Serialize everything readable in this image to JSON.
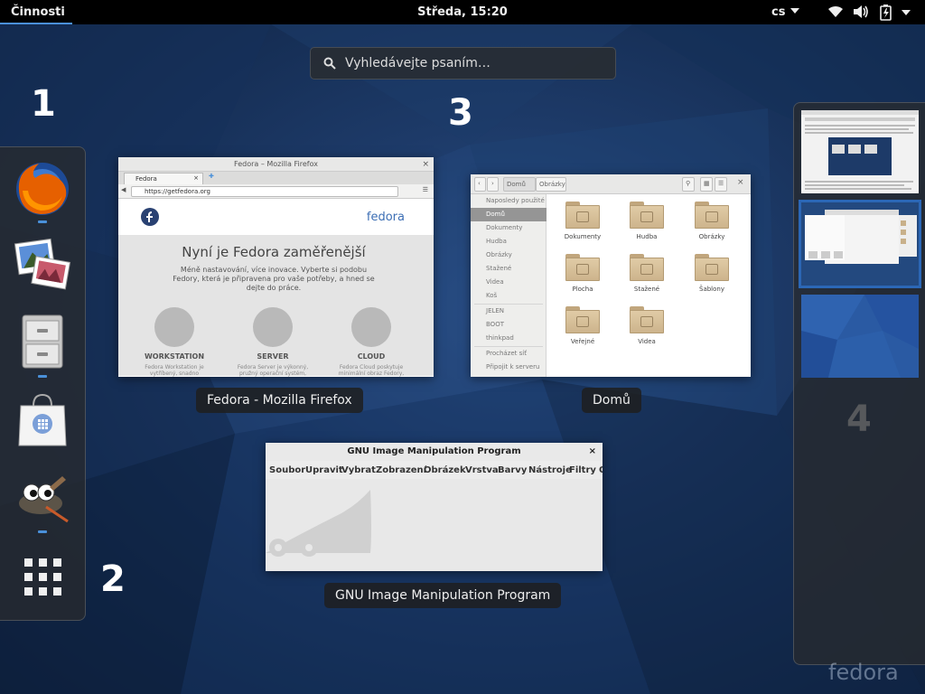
{
  "top_bar": {
    "activities_label": "Činnosti",
    "clock": "Středa, 15:20",
    "language": "cs",
    "icons": [
      "network-wireless-icon",
      "volume-icon",
      "battery-icon",
      "system-menu-icon"
    ]
  },
  "search": {
    "placeholder": "Vyhledávejte psaním…"
  },
  "callouts": [
    "1",
    "2",
    "3",
    "4"
  ],
  "dash": {
    "apps": [
      "firefox-icon",
      "shotwell-icon",
      "files-icon",
      "software-icon",
      "gimp-icon",
      "show-applications-icon"
    ]
  },
  "windows": {
    "firefox": {
      "caption": "Fedora - Mozilla Firefox",
      "titlebar": "Fedora – Mozilla Firefox",
      "tab": "Fedora",
      "url": "https://getfedora.org",
      "brand": "fedora",
      "headline": "Nyní je Fedora zaměřenější",
      "paragraph": "Méně nastavování, více inovace. Vyberte si podobu Fedory, která je připravena pro vaše potřeby, a hned se dejte do práce.",
      "editions": [
        {
          "label": "WORKSTATION",
          "desc": "Fedora Workstation je vytříbený, snadno použitelný operační systém"
        },
        {
          "label": "SERVER",
          "desc": "Fedora Server je výkonný, pružný operační systém, který obsahuje to"
        },
        {
          "label": "CLOUD",
          "desc": "Fedora Cloud poskytuje minimální obraz Fedory, který lze použít v"
        }
      ]
    },
    "files": {
      "caption": "Domů",
      "path_home": "Domů",
      "path_next": "Obrázky",
      "sidebar": [
        "Naposledy použité",
        "Domů",
        "Dokumenty",
        "Hudba",
        "Obrázky",
        "Stažené",
        "Videa",
        "Koš",
        "JELEN",
        "BOOT",
        "thinkpad",
        "Procházet síť",
        "Připojit k serveru"
      ],
      "folders": [
        "Dokumenty",
        "Hudba",
        "Obrázky",
        "Plocha",
        "Stažené",
        "Šablony",
        "Veřejné",
        "Videa"
      ]
    },
    "gimp": {
      "caption": "GNU Image Manipulation Program",
      "titlebar": "GNU Image Manipulation Program",
      "menu": [
        "Soubor",
        "Upravit",
        "Vybrat",
        "Zobrazení",
        "Obrázek",
        "Vrstva",
        "Barvy",
        "Nástroje",
        "Filtry",
        "O"
      ]
    }
  },
  "workspaces": {
    "count": 3,
    "active": 2
  },
  "watermark": "fedora",
  "colors": {
    "accent": "#4a90d9",
    "panel": "#000000",
    "fedora_blue": "#294172"
  }
}
